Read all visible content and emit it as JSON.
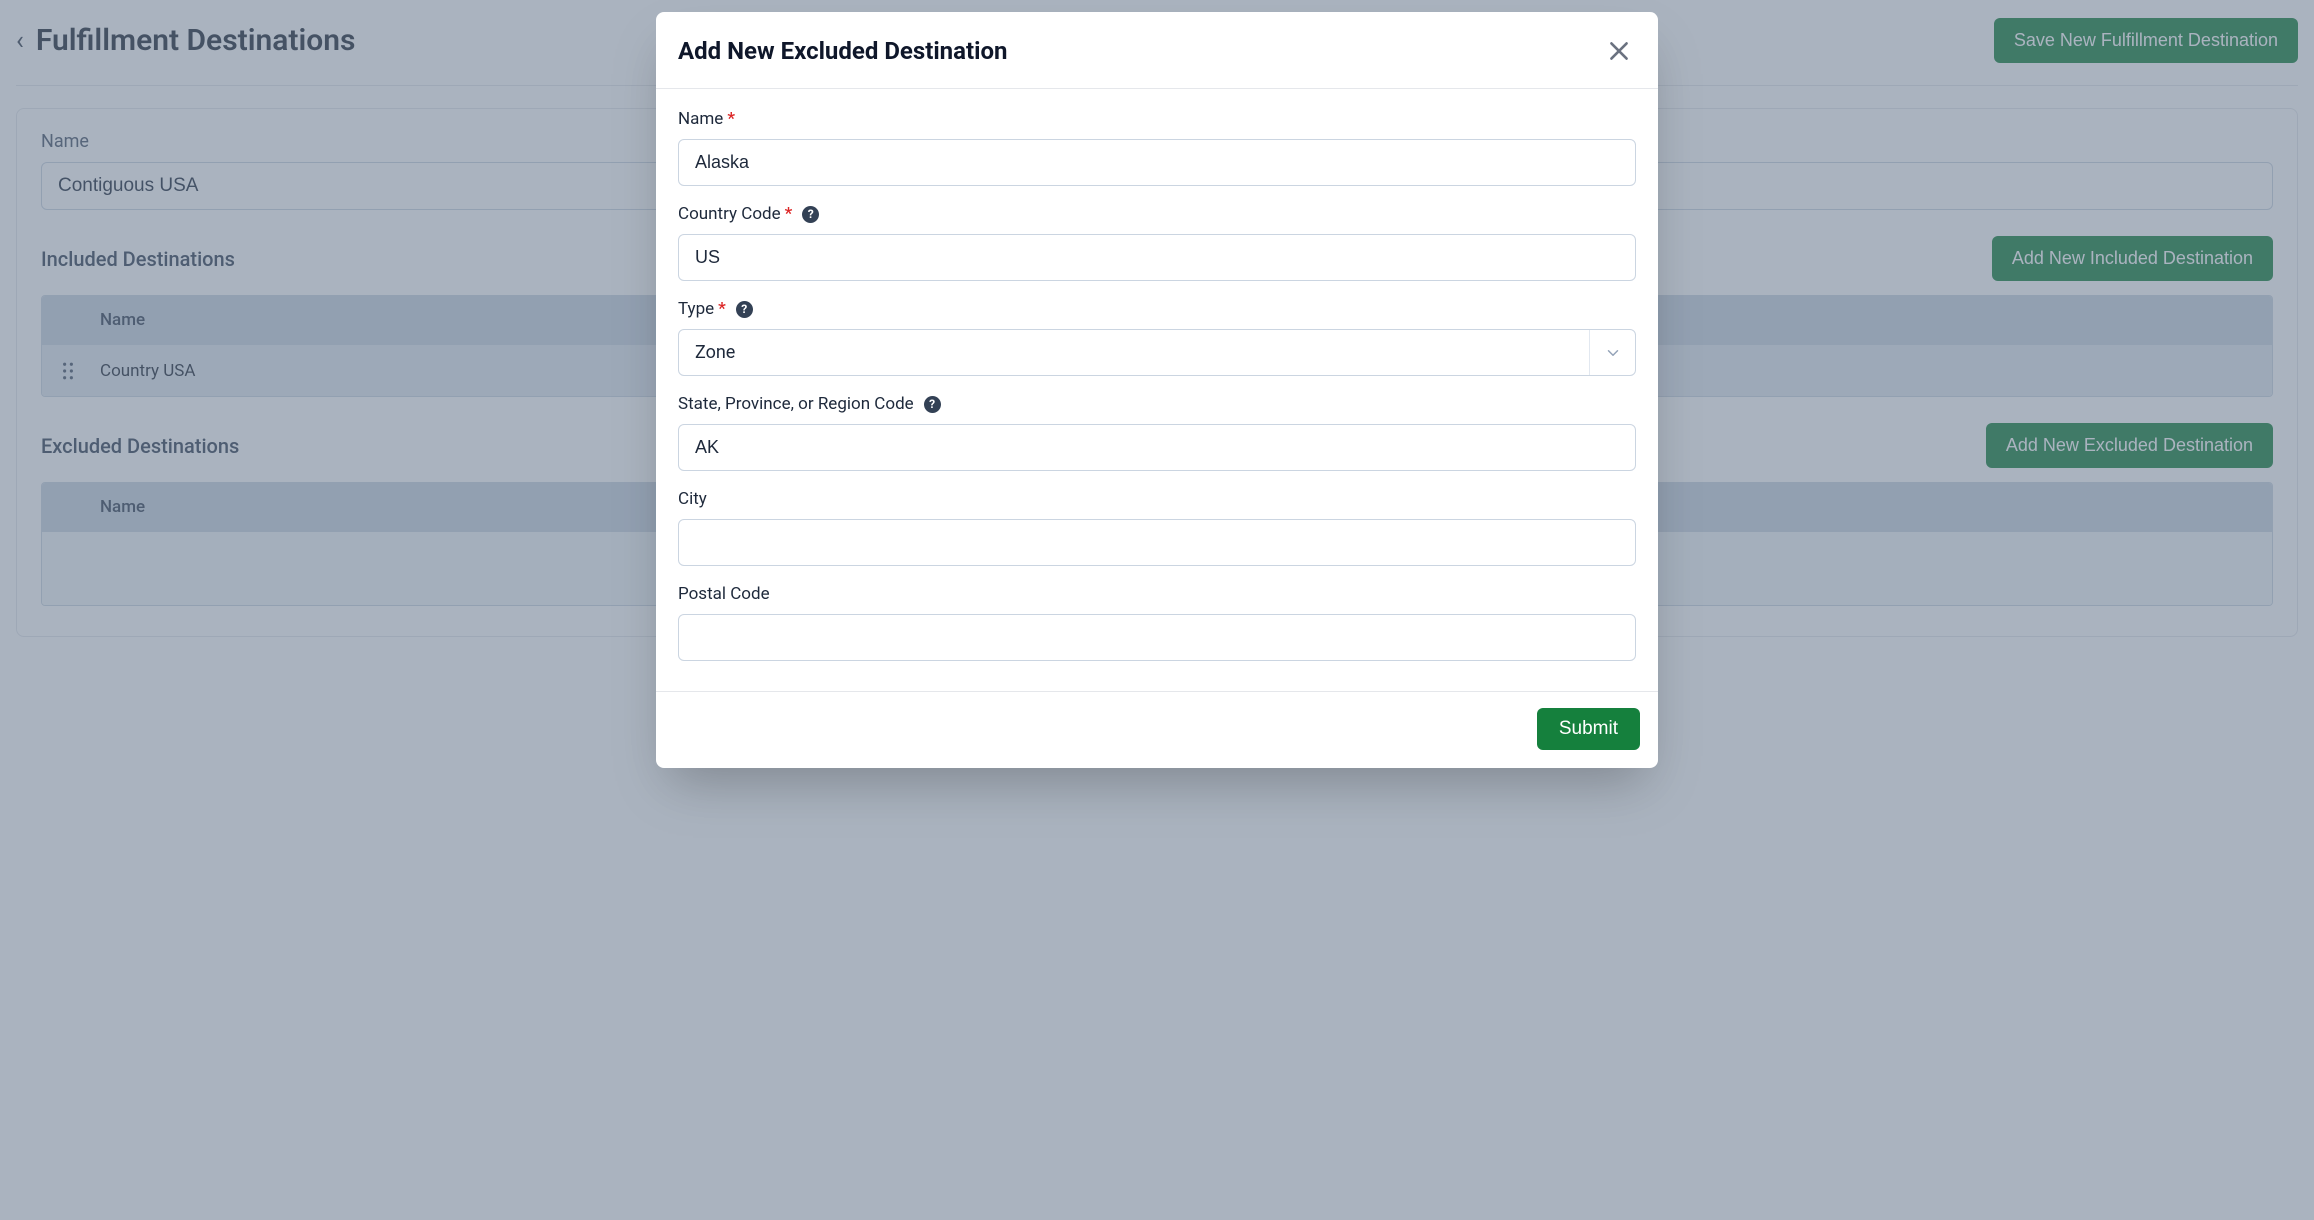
{
  "page": {
    "title": "Fulfillment Destinations",
    "save_button": "Save New Fulfillment Destination",
    "name_label": "Name",
    "name_value": "Contiguous USA",
    "included": {
      "section_title": "Included Destinations",
      "add_button": "Add New Included Destination",
      "column_name": "Name",
      "rows": [
        {
          "name": "Country USA"
        }
      ]
    },
    "excluded": {
      "section_title": "Excluded Destinations",
      "add_button": "Add New Excluded Destination",
      "column_name": "Name",
      "rows": []
    }
  },
  "modal": {
    "title": "Add New Excluded Destination",
    "fields": {
      "name": {
        "label": "Name",
        "required": true,
        "value": "Alaska"
      },
      "country_code": {
        "label": "Country Code",
        "required": true,
        "has_help": true,
        "value": "US"
      },
      "type": {
        "label": "Type",
        "required": true,
        "has_help": true,
        "value": "Zone"
      },
      "region_code": {
        "label": "State, Province, or Region Code",
        "required": false,
        "has_help": true,
        "value": "AK"
      },
      "city": {
        "label": "City",
        "required": false,
        "value": ""
      },
      "postal_code": {
        "label": "Postal Code",
        "required": false,
        "value": ""
      }
    },
    "submit": "Submit"
  }
}
